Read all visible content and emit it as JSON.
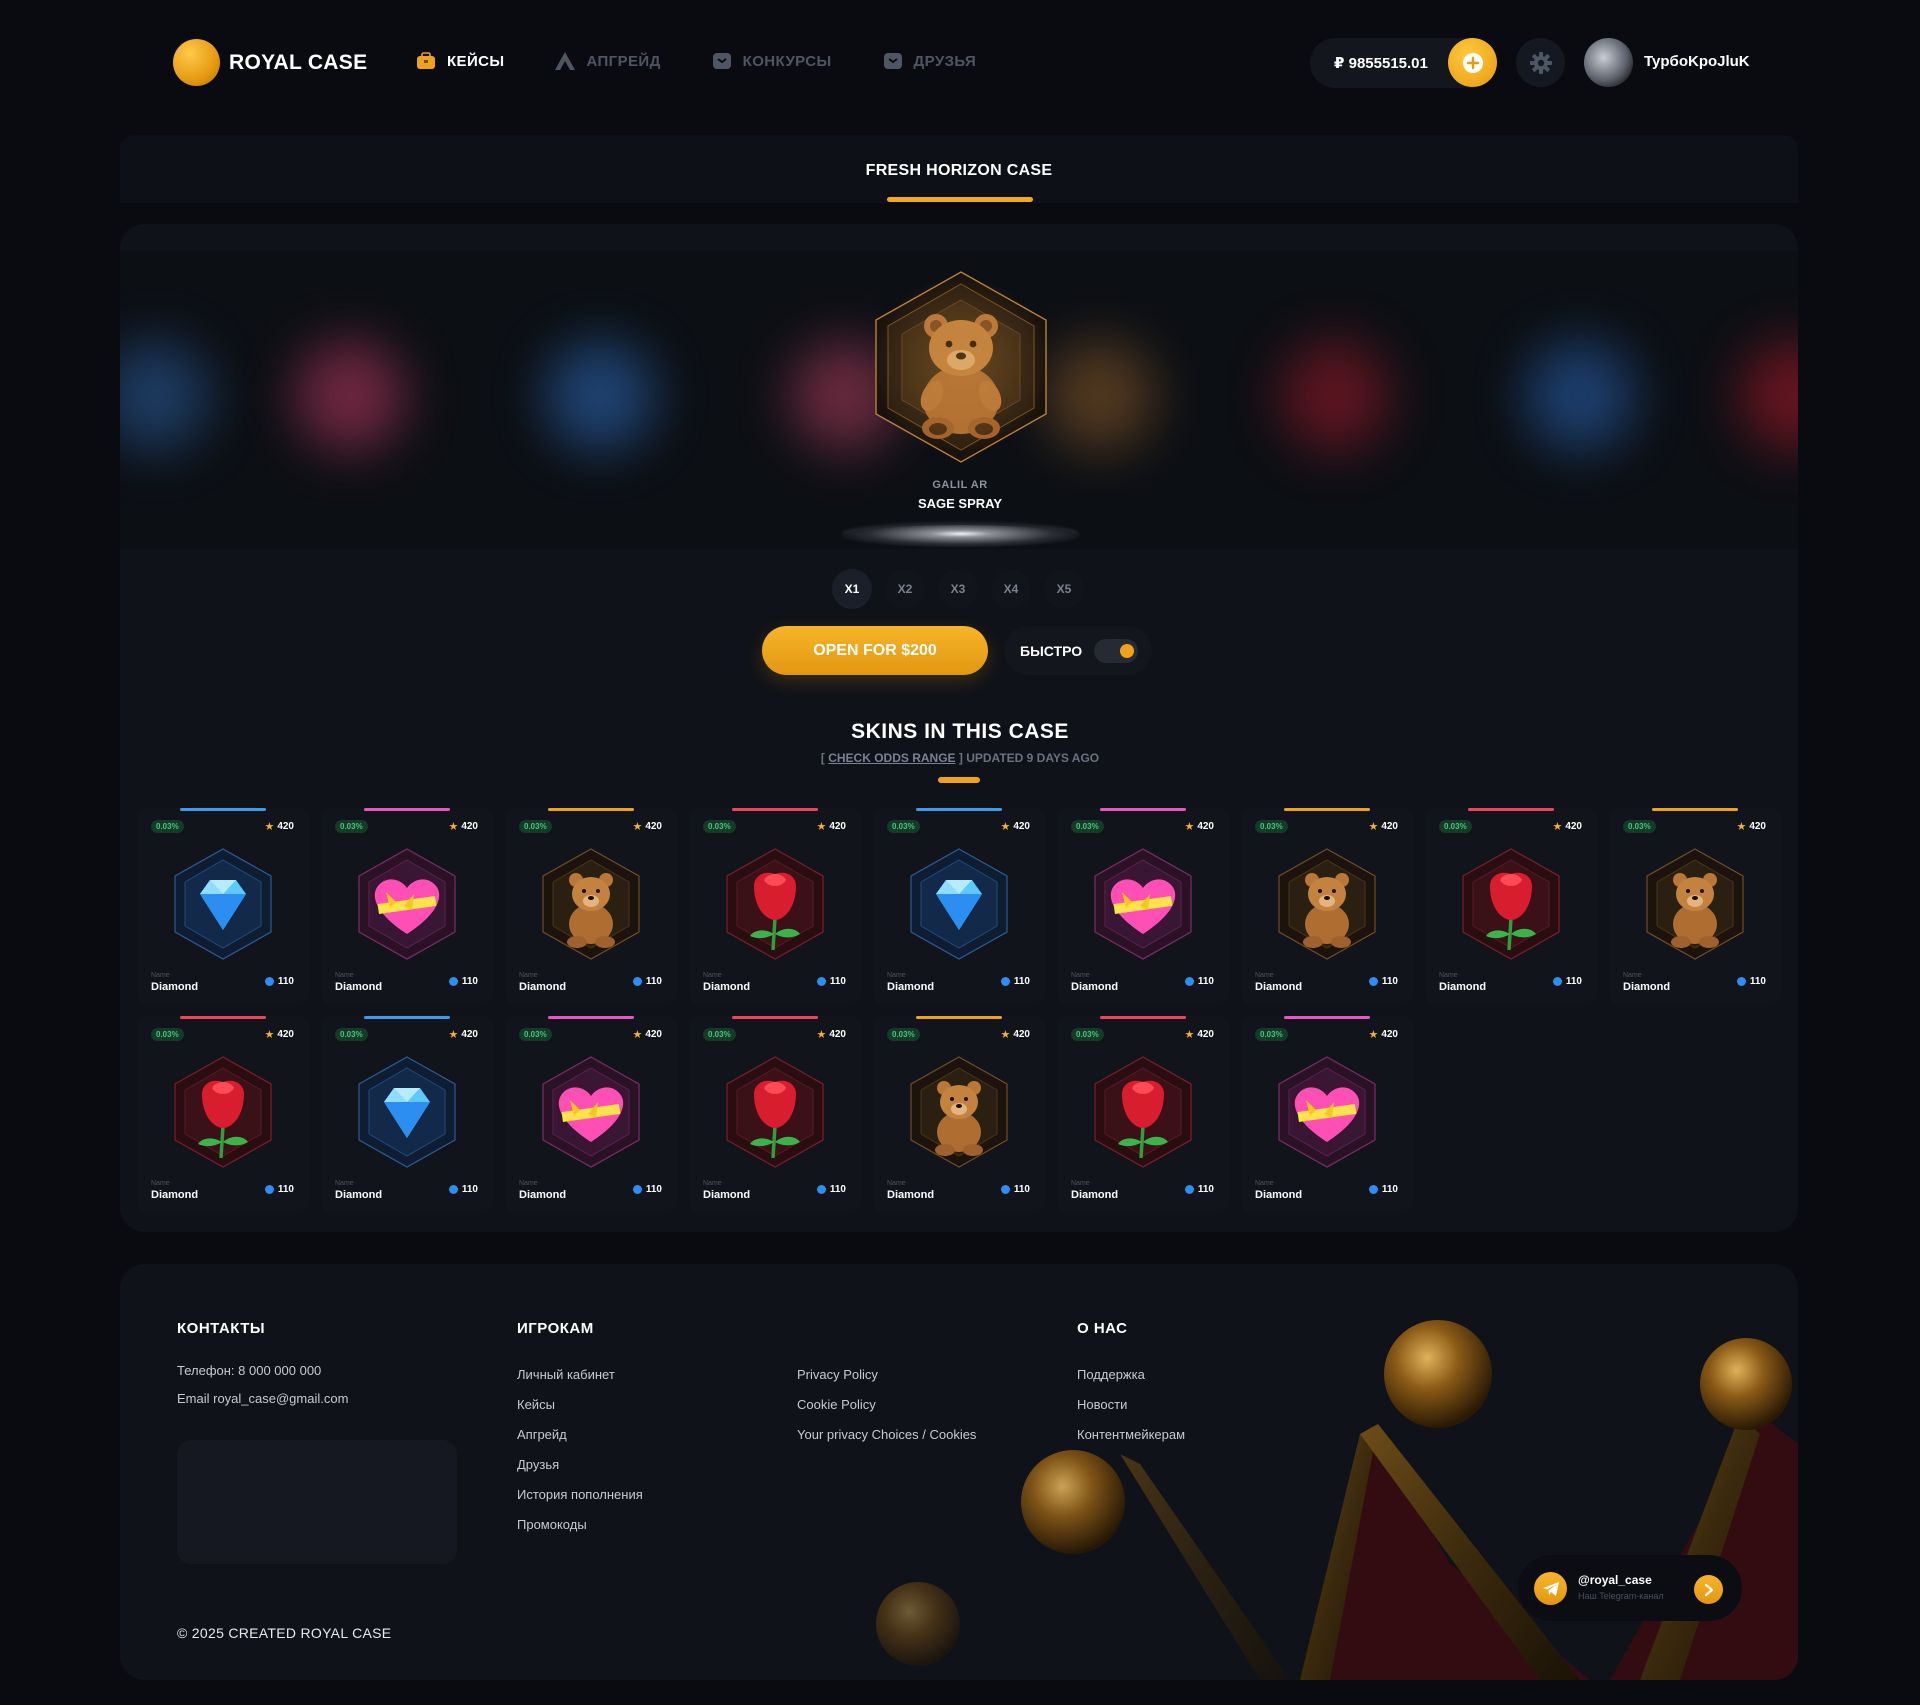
{
  "brand": {
    "name": "ROYAL CASE"
  },
  "nav": [
    {
      "label": "КЕЙСЫ",
      "icon": "case-icon",
      "active": true
    },
    {
      "label": "АПГРЕЙД",
      "icon": "upgrade-icon",
      "active": false
    },
    {
      "label": "КОНКУРСЫ",
      "icon": "contest-icon",
      "active": false
    },
    {
      "label": "ДРУЗЬЯ",
      "icon": "friends-icon",
      "active": false
    }
  ],
  "user": {
    "balance": "₽ 9855515.01",
    "name": "TypбoKpoJluK"
  },
  "case": {
    "title": "FRESH HORIZON CASE"
  },
  "roulette": {
    "item_sub": "GALIL AR",
    "item_name": "SAGE SPRAY"
  },
  "multipliers": [
    "X1",
    "X2",
    "X3",
    "X4",
    "X5"
  ],
  "active_multiplier": "X1",
  "actions": {
    "open_label": "OPEN FOR $200",
    "fast_label": "БЫСТРО",
    "fast_enabled": true
  },
  "skins": {
    "title": "SKINS IN THIS CASE",
    "sub_open": "[ ",
    "sub_link": "CHECK ODDS RANGE",
    "sub_close": " ] UPDATED 9 DAYS AGO",
    "items": [
      {
        "kind": "diamond",
        "chance": "0.03%",
        "score": "420",
        "name_label": "Name",
        "name": "Diamond",
        "price": "110",
        "accent": "#3a9bf0"
      },
      {
        "kind": "heart",
        "chance": "0.03%",
        "score": "420",
        "name_label": "Name",
        "name": "Diamond",
        "price": "110",
        "accent": "#e956c4"
      },
      {
        "kind": "bear",
        "chance": "0.03%",
        "score": "420",
        "name_label": "Name",
        "name": "Diamond",
        "price": "110",
        "accent": "#f0a21d"
      },
      {
        "kind": "rose",
        "chance": "0.03%",
        "score": "420",
        "name_label": "Name",
        "name": "Diamond",
        "price": "110",
        "accent": "#f0455a"
      },
      {
        "kind": "diamond",
        "chance": "0.03%",
        "score": "420",
        "name_label": "Name",
        "name": "Diamond",
        "price": "110",
        "accent": "#3a9bf0"
      },
      {
        "kind": "heart",
        "chance": "0.03%",
        "score": "420",
        "name_label": "Name",
        "name": "Diamond",
        "price": "110",
        "accent": "#e956c4"
      },
      {
        "kind": "bear",
        "chance": "0.03%",
        "score": "420",
        "name_label": "Name",
        "name": "Diamond",
        "price": "110",
        "accent": "#f0a21d"
      },
      {
        "kind": "rose",
        "chance": "0.03%",
        "score": "420",
        "name_label": "Name",
        "name": "Diamond",
        "price": "110",
        "accent": "#f0455a"
      },
      {
        "kind": "bear",
        "chance": "0.03%",
        "score": "420",
        "name_label": "Name",
        "name": "Diamond",
        "price": "110",
        "accent": "#f0a21d"
      },
      {
        "kind": "rose",
        "chance": "0.03%",
        "score": "420",
        "name_label": "Name",
        "name": "Diamond",
        "price": "110",
        "accent": "#f0455a"
      },
      {
        "kind": "diamond",
        "chance": "0.03%",
        "score": "420",
        "name_label": "Name",
        "name": "Diamond",
        "price": "110",
        "accent": "#3a9bf0"
      },
      {
        "kind": "heart",
        "chance": "0.03%",
        "score": "420",
        "name_label": "Name",
        "name": "Diamond",
        "price": "110",
        "accent": "#e956c4"
      },
      {
        "kind": "rose",
        "chance": "0.03%",
        "score": "420",
        "name_label": "Name",
        "name": "Diamond",
        "price": "110",
        "accent": "#f0455a"
      },
      {
        "kind": "bear",
        "chance": "0.03%",
        "score": "420",
        "name_label": "Name",
        "name": "Diamond",
        "price": "110",
        "accent": "#f0a21d"
      },
      {
        "kind": "rose",
        "chance": "0.03%",
        "score": "420",
        "name_label": "Name",
        "name": "Diamond",
        "price": "110",
        "accent": "#f0455a"
      },
      {
        "kind": "heart",
        "chance": "0.03%",
        "score": "420",
        "name_label": "Name",
        "name": "Diamond",
        "price": "110",
        "accent": "#e956c4"
      }
    ]
  },
  "footer": {
    "contacts_title": "КОНТАКТЫ",
    "phone": "Телефон: 8 000 000 000",
    "email": "Email royal_case@gmail.com",
    "players_title": "ИГРОКАМ",
    "players_links": [
      "Личный кабинет",
      "Кейсы",
      "Апгрейд",
      "Друзья",
      "История пополнения",
      "Промокоды"
    ],
    "policy_links": [
      "Privacy Policy",
      "Cookie Policy",
      "Your privacy Choices / Cookies"
    ],
    "about_title": "О НАС",
    "about_links": [
      "Поддержка",
      "Новости",
      "Контентмейкерам"
    ],
    "copyright": "© 2025 CREATED ROYAL CASE",
    "telegram_name": "@royal_case",
    "telegram_sub": "Наш Telegram-канал"
  },
  "colors": {
    "accent": "#f0a21d",
    "background": "#090b10",
    "panel": "#0f1218",
    "chance_green": "#43c77c"
  }
}
